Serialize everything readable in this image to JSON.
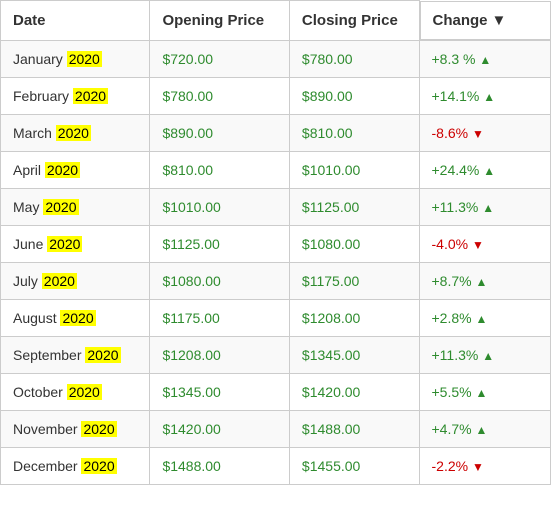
{
  "table": {
    "headers": {
      "date": "Date",
      "opening": "Opening Price",
      "closing": "Closing Price",
      "change": "Change"
    },
    "rows": [
      {
        "month": "January",
        "year": "2020",
        "opening": "$720.00",
        "closing": "$780.00",
        "change": "+8.3 %",
        "positive": true
      },
      {
        "month": "February",
        "year": "2020",
        "opening": "$780.00",
        "closing": "$890.00",
        "change": "+14.1%",
        "positive": true
      },
      {
        "month": "March",
        "year": "2020",
        "opening": "$890.00",
        "closing": "$810.00",
        "change": "-8.6%",
        "positive": false
      },
      {
        "month": "April",
        "year": "2020",
        "opening": "$810.00",
        "closing": "$1010.00",
        "change": "+24.4%",
        "positive": true
      },
      {
        "month": "May",
        "year": "2020",
        "opening": "$1010.00",
        "closing": "$1125.00",
        "change": "+11.3%",
        "positive": true
      },
      {
        "month": "June",
        "year": "2020",
        "opening": "$1125.00",
        "closing": "$1080.00",
        "change": "-4.0%",
        "positive": false
      },
      {
        "month": "July",
        "year": "2020",
        "opening": "$1080.00",
        "closing": "$1175.00",
        "change": "+8.7%",
        "positive": true
      },
      {
        "month": "August",
        "year": "2020",
        "opening": "$1175.00",
        "closing": "$1208.00",
        "change": "+2.8%",
        "positive": true
      },
      {
        "month": "September",
        "year": "2020",
        "opening": "$1208.00",
        "closing": "$1345.00",
        "change": "+11.3%",
        "positive": true
      },
      {
        "month": "October",
        "year": "2020",
        "opening": "$1345.00",
        "closing": "$1420.00",
        "change": "+5.5%",
        "positive": true
      },
      {
        "month": "November",
        "year": "2020",
        "opening": "$1420.00",
        "closing": "$1488.00",
        "change": "+4.7%",
        "positive": true
      },
      {
        "month": "December",
        "year": "2020",
        "opening": "$1488.00",
        "closing": "$1455.00",
        "change": "-2.2%",
        "positive": false
      }
    ]
  }
}
